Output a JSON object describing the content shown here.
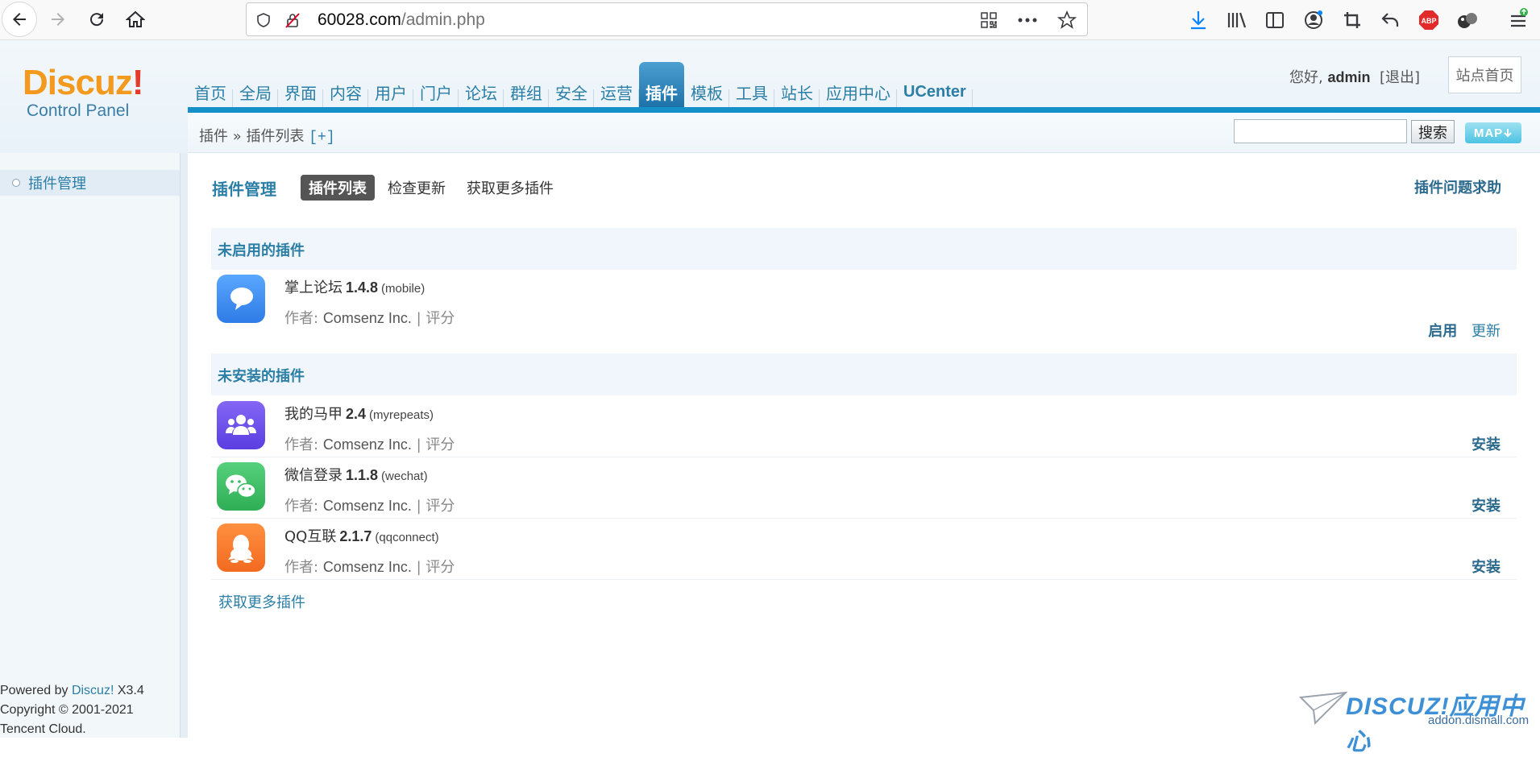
{
  "browser": {
    "url_host": "60028.com",
    "url_path": "/admin.php"
  },
  "header": {
    "logo_brand": "Discuz",
    "logo_bang": "!",
    "logo_sub": "Control Panel",
    "nav": [
      "首页",
      "全局",
      "界面",
      "内容",
      "用户",
      "门户",
      "论坛",
      "群组",
      "安全",
      "运营",
      "插件",
      "模板",
      "工具",
      "站长",
      "应用中心",
      "UCenter"
    ],
    "active_nav": "插件",
    "greeting": "您好,",
    "username": "admin",
    "logout": "[退出]",
    "site_index": "站点首页"
  },
  "breadcrumb": {
    "root": "插件",
    "sep": "»",
    "current": "插件列表",
    "add": "[+]",
    "search_button": "搜索",
    "map_button": "MAP"
  },
  "sidebar": {
    "items": [
      {
        "label": "插件管理"
      }
    ],
    "footer_powered_pre": "Powered by ",
    "footer_powered_link": "Discuz!",
    "footer_powered_ver": " X3.4",
    "footer_copyright": "Copyright © 2001-2021",
    "footer_company": "Tencent Cloud."
  },
  "main": {
    "title": "插件管理",
    "tabs": [
      "插件列表",
      "检查更新",
      "获取更多插件"
    ],
    "help": "插件问题求助",
    "sections": [
      {
        "title": "未启用的插件",
        "plugins": [
          {
            "name": "掌上论坛",
            "version": "1.4.8",
            "id": "(mobile)",
            "author_label": "作者:",
            "author": "Comsenz Inc.",
            "sep": "|",
            "rating": "评分",
            "actions": [
              "启用",
              "更新"
            ],
            "color": "#3d8ff2"
          }
        ]
      },
      {
        "title": "未安装的插件",
        "plugins": [
          {
            "name": "我的马甲",
            "version": "2.4",
            "id": "(myrepeats)",
            "author_label": "作者:",
            "author": "Comsenz Inc.",
            "sep": "|",
            "rating": "评分",
            "actions": [
              "安装"
            ],
            "color": "#6a4ee8"
          },
          {
            "name": "微信登录",
            "version": "1.1.8",
            "id": "(wechat)",
            "author_label": "作者:",
            "author": "Comsenz Inc.",
            "sep": "|",
            "rating": "评分",
            "actions": [
              "安装"
            ],
            "color": "#3cbd63"
          },
          {
            "name": "QQ互联",
            "version": "2.1.7",
            "id": "(qqconnect)",
            "author_label": "作者:",
            "author": "Comsenz Inc.",
            "sep": "|",
            "rating": "评分",
            "actions": [
              "安装"
            ],
            "color": "#f57a2c"
          }
        ]
      }
    ],
    "more_link": "获取更多插件"
  },
  "watermark": {
    "brand": "DISCUZ!应用中心",
    "domain": "addon.dismall.com"
  }
}
